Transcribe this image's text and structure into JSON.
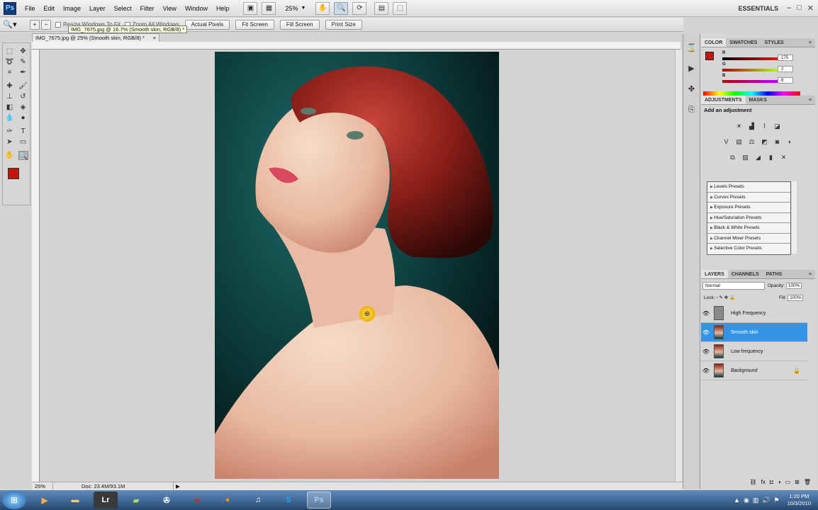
{
  "menubar": {
    "items": [
      "File",
      "Edit",
      "Image",
      "Layer",
      "Select",
      "Filter",
      "View",
      "Window",
      "Help"
    ],
    "zoom": "25%",
    "workspace": "ESSENTIALS"
  },
  "options": {
    "resize_windows": "Resize Windows To Fit",
    "zoom_all": "Zoom All Windows",
    "buttons": [
      "Actual Pixels",
      "Fit Screen",
      "Fill Screen",
      "Print Size"
    ]
  },
  "document": {
    "tab_title": "IMG_7675.jpg @ 25% (Smooth skin, RGB/8) *",
    "tab_close": "×",
    "tooltip": "IMG_7675.jpg @ 16.7% (Smooth skin, RGB/8) *"
  },
  "status": {
    "zoom": "25%",
    "doc_size": "Doc: 23.4M/93.1M"
  },
  "color_panel": {
    "tabs": [
      "COLOR",
      "SWATCHES",
      "STYLES"
    ],
    "r_label": "R",
    "g_label": "G",
    "b_label": "B",
    "r": "175",
    "g": "2",
    "b": "8",
    "fg_color": "#c4120c",
    "bg_color": "#f07030"
  },
  "adjustments": {
    "tabs": [
      "ADJUSTMENTS",
      "MASKS"
    ],
    "title": "Add an adjustment",
    "presets": [
      "Levels Presets",
      "Curves Presets",
      "Exposure Presets",
      "Hue/Saturation Presets",
      "Black & White Presets",
      "Channel Mixer Presets",
      "Selective Color Presets"
    ]
  },
  "layers": {
    "tabs": [
      "LAYERS",
      "CHANNELS",
      "PATHS"
    ],
    "blend_mode": "Normal",
    "opacity_label": "Opacity:",
    "opacity": "100%",
    "lock_label": "Lock:",
    "fill_label": "Fill:",
    "fill": "100%",
    "items": [
      {
        "name": "High Frequency"
      },
      {
        "name": "Smooth skin"
      },
      {
        "name": "Low frequency"
      },
      {
        "name": "Background"
      }
    ]
  },
  "taskbar": {
    "time": "1:20 PM",
    "date": "10/3/2010",
    "apps": [
      "Lr",
      "Ps"
    ]
  }
}
